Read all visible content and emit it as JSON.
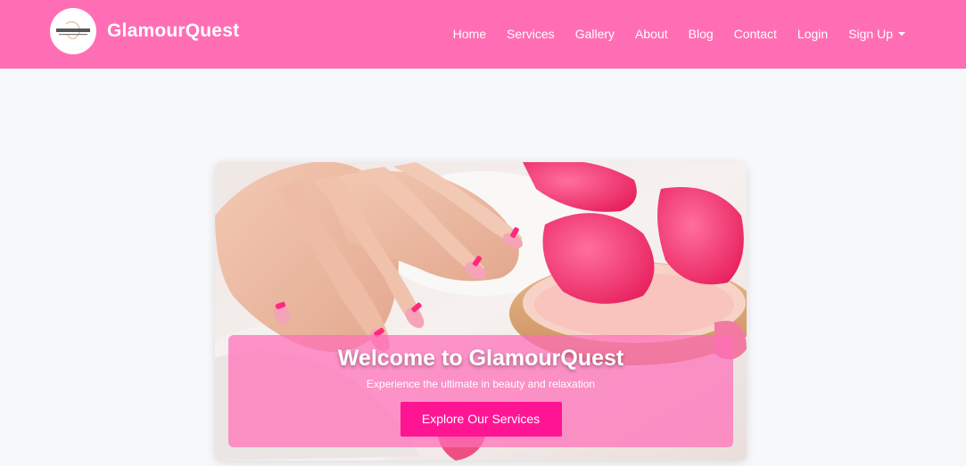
{
  "brand": {
    "name": "GlamourQuest",
    "logo_text": "GLAMOURQUEST"
  },
  "nav": {
    "items": [
      {
        "label": "Home"
      },
      {
        "label": "Services"
      },
      {
        "label": "Gallery"
      },
      {
        "label": "About"
      },
      {
        "label": "Blog"
      },
      {
        "label": "Contact"
      },
      {
        "label": "Login"
      },
      {
        "label": "Sign Up"
      }
    ]
  },
  "hero": {
    "title": "Welcome to GlamourQuest",
    "subtitle": "Experience the ultimate in beauty and relaxation",
    "cta_label": "Explore Our Services"
  },
  "colors": {
    "navbar": "#ff6eb4",
    "page_background": "#f7f8fa",
    "cta_button": "#ff1493",
    "overlay": "rgba(255,110,185,0.72)"
  }
}
